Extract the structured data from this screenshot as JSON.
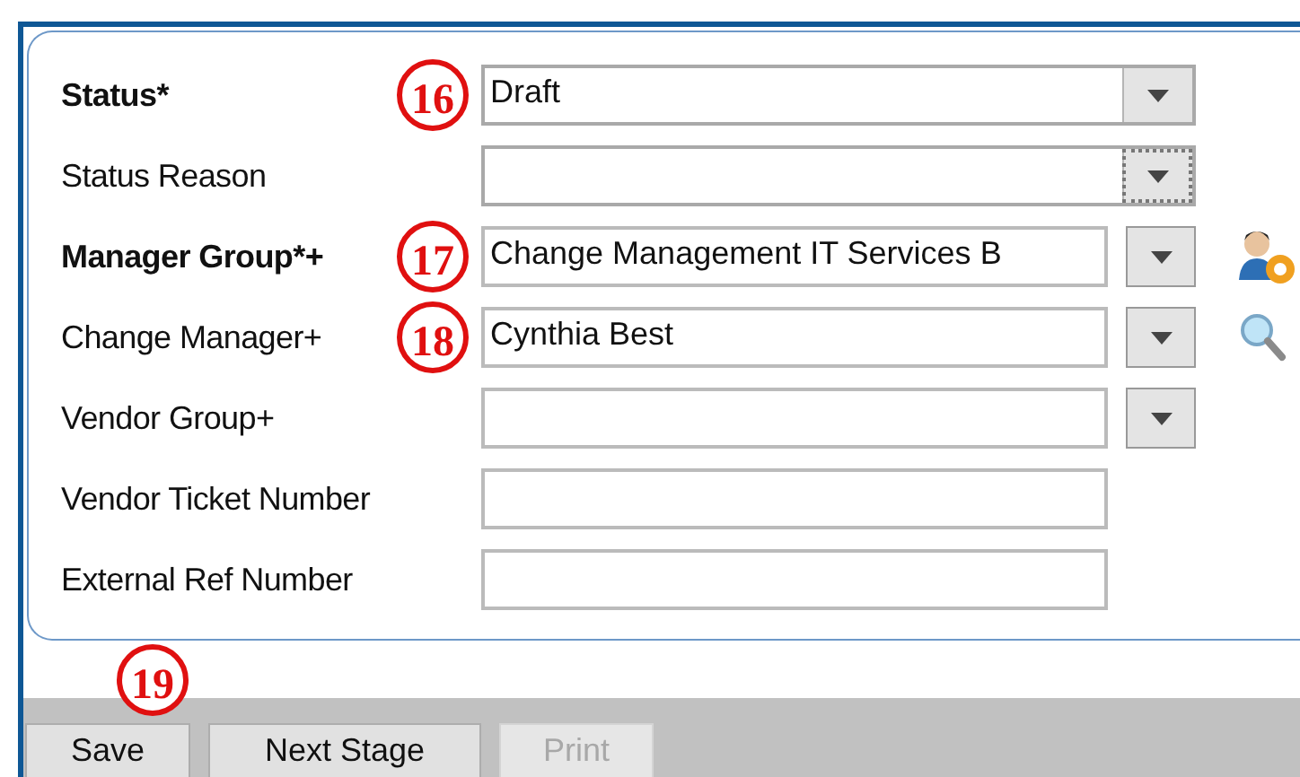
{
  "fields": [
    {
      "label": "Status*",
      "bold": true,
      "kind": "combo",
      "value": "Draft",
      "callout": "16",
      "focused": false
    },
    {
      "label": "Status Reason",
      "bold": false,
      "kind": "combo",
      "focused": true
    },
    {
      "label": "Manager Group*+",
      "bold": true,
      "kind": "lookup",
      "value": "Change Management IT Services B",
      "callout": "17",
      "focused": false,
      "side": {
        "kind": "person"
      }
    },
    {
      "label": "Change Manager+",
      "bold": false,
      "kind": "lookup",
      "value": "Cynthia Best",
      "callout": "18",
      "focused": false,
      "side": {
        "kind": "search"
      }
    },
    {
      "label": "Vendor Group+",
      "bold": false,
      "kind": "lookup",
      "focused": false
    },
    {
      "label": "Vendor Ticket Number",
      "bold": false,
      "kind": "text"
    },
    {
      "label": "External Ref Number",
      "bold": false,
      "kind": "text"
    }
  ],
  "footer": {
    "callout": "19",
    "buttons": [
      {
        "label": "Save",
        "disabled": false
      },
      {
        "label": "Next Stage",
        "disabled": false
      },
      {
        "label": "Print",
        "disabled": true
      }
    ]
  }
}
